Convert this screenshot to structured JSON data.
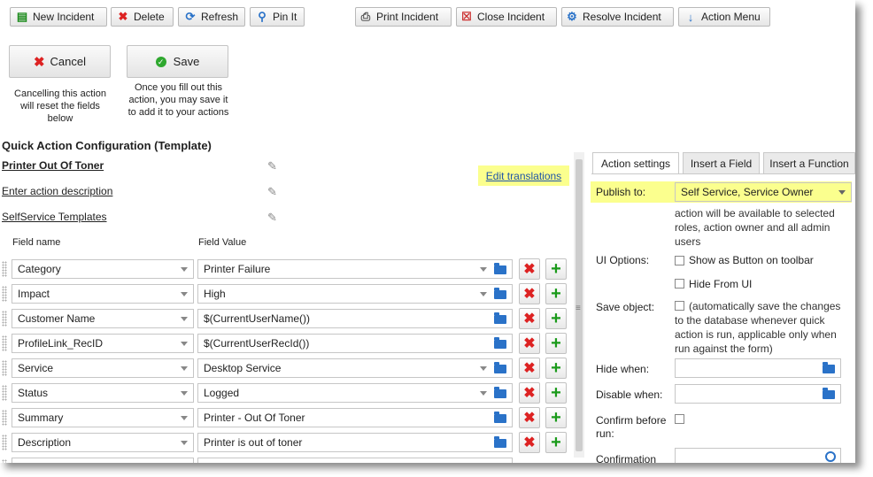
{
  "toolbar": {
    "new_incident": "New Incident",
    "delete": "Delete",
    "refresh": "Refresh",
    "pin_it": "Pin It",
    "print_incident": "Print Incident",
    "close_incident": "Close Incident",
    "resolve_incident": "Resolve Incident",
    "action_menu": "Action Menu"
  },
  "actions": {
    "cancel_label": "Cancel",
    "save_label": "Save",
    "cancel_hint": "Cancelling this action will reset the fields below",
    "save_hint": "Once you fill out this action, you may save it to add it to your actions"
  },
  "config": {
    "title": "Quick Action Configuration (Template)",
    "name": "Printer Out Of Toner",
    "description": "Enter action description",
    "category": "SelfService Templates",
    "edit_translations": "Edit translations",
    "col_field_name": "Field name",
    "col_field_value": "Field Value"
  },
  "fields": [
    {
      "name": "Category",
      "value": "Printer Failure",
      "dropdown": true
    },
    {
      "name": "Impact",
      "value": "High",
      "dropdown": true
    },
    {
      "name": "Customer Name",
      "value": "$(CurrentUserName())",
      "dropdown": false
    },
    {
      "name": "ProfileLink_RecID",
      "value": "$(CurrentUserRecId())",
      "dropdown": false
    },
    {
      "name": "Service",
      "value": "Desktop Service",
      "dropdown": true
    },
    {
      "name": "Status",
      "value": "Logged",
      "dropdown": true
    },
    {
      "name": "Summary",
      "value": "Printer - Out Of Toner",
      "dropdown": false
    },
    {
      "name": "Description",
      "value": "Printer is out of toner",
      "dropdown": false
    }
  ],
  "panel": {
    "tabs": [
      "Action settings",
      "Insert a Field",
      "Insert a Function"
    ],
    "publish_to_label": "Publish to:",
    "publish_to_value": "Self Service, Service Owner",
    "publish_note": "action will be available to selected roles, action owner and all admin users",
    "ui_options_label": "UI Options:",
    "show_as_button": "Show as Button on toolbar",
    "hide_from_ui": "Hide From UI",
    "save_object_label": "Save object:",
    "save_object_note": "(automatically save the changes to the database whenever quick action is run, applicable only when run against the form)",
    "hide_when_label": "Hide when:",
    "disable_when_label": "Disable when:",
    "confirm_label": "Confirm before run:",
    "confirmation_label": "Confirmation"
  },
  "colors": {
    "highlight": "#fbff8e",
    "link": "#1f54a8",
    "delete": "#dd2222",
    "add": "#1a9a1a",
    "folder": "#2a72c8"
  }
}
